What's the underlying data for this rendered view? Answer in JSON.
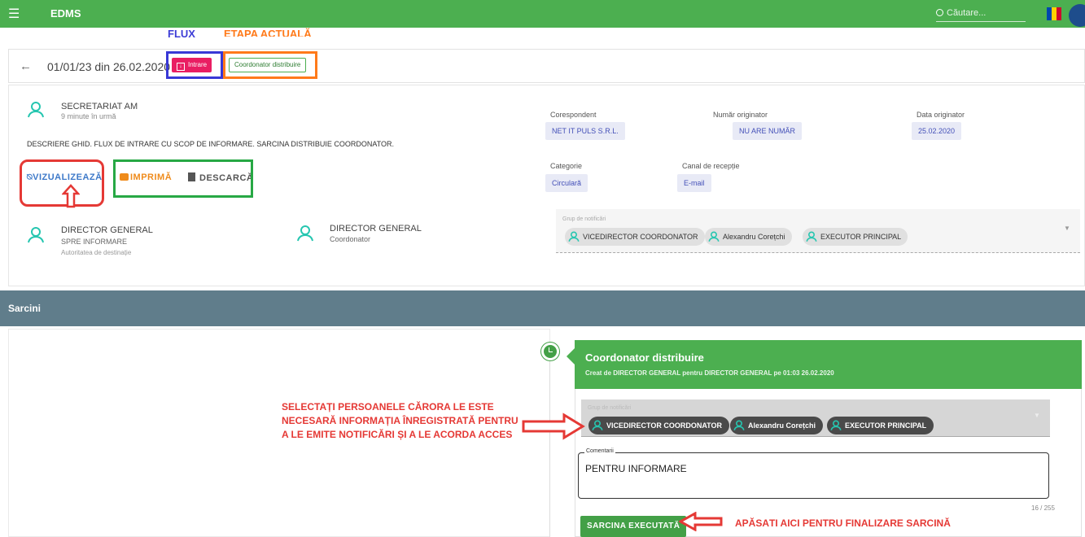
{
  "app": {
    "title": "EDMS",
    "search_placeholder": "Căutare..."
  },
  "colors": {
    "appbar": "#4caf50",
    "sarcini_bar": "#607d8b",
    "intrare_badge": "#e91e63",
    "annotation_red": "#e53935",
    "annotation_blue": "#3838d6",
    "annotation_orange": "#ff7a1a",
    "annotation_green": "#27a844"
  },
  "annotations": {
    "flux": "FLUX",
    "etapa": "ETAPA ACTUALĂ",
    "select_notice": "SELECTAȚI PERSOANELE CĂRORA LE ESTE NECESARĂ INFORMAȚIA ÎNREGISTRATĂ PENTRU A LE EMITE NOTIFICĂRI ȘI A LE ACORDA ACCES",
    "finalize_notice": "APĂSAȚI AICI PENTRU FINALIZARE SARCINĂ"
  },
  "document": {
    "id": "01/01/23 din 26.02.2020",
    "flow_badge": "Intrare",
    "stage_badge": "Coordonator distribuire"
  },
  "sender": {
    "name": "SECRETARIAT AM",
    "time": "9 minute în urmă",
    "description": "DESCRIERE GHID. FLUX DE INTRARE CU SCOP DE INFORMARE. SARCINA DISTRIBUIE COORDONATOR."
  },
  "actions": {
    "view": "VIZUALIZEAZĂ",
    "print": "IMPRIMĂ",
    "download": "DESCARCĂ"
  },
  "fields": {
    "correspondent": {
      "label": "Corespondent",
      "value": "NET IT PULS S.R.L."
    },
    "originator_number": {
      "label": "Număr originator",
      "value": "NU ARE NUMĂR"
    },
    "originator_date": {
      "label": "Data originator",
      "value": "25.02.2020"
    },
    "category": {
      "label": "Categorie",
      "value": "Circulară"
    },
    "reception_channel": {
      "label": "Canal de recepție",
      "value": "E-mail"
    }
  },
  "recipients": [
    {
      "name": "DIRECTOR GENERAL",
      "sub": "SPRE INFORMARE",
      "sub2": "Autoritatea de destinație"
    },
    {
      "name": "DIRECTOR GENERAL",
      "sub": "Coordonator"
    }
  ],
  "notification_group": {
    "label": "Grup de notificări",
    "members": [
      "VICEDIRECTOR COORDONATOR",
      "Alexandru Corețchi",
      "EXECUTOR PRINCIPAL"
    ]
  },
  "tasks": {
    "section_title": "Sarcini",
    "card": {
      "title": "Coordonator distribuire",
      "subtitle": "Creat de DIRECTOR GENERAL pentru DIRECTOR GENERAL pe 01:03 26.02.2020",
      "group_label": "Grup de notificări",
      "members": [
        "VICEDIRECTOR COORDONATOR",
        "Alexandru Corețchi",
        "EXECUTOR PRINCIPAL"
      ],
      "comment_label": "Comentarii",
      "comment_value": "PENTRU INFORMARE",
      "counter": "16 / 255",
      "submit": "SARCINA EXECUTATĂ"
    }
  }
}
